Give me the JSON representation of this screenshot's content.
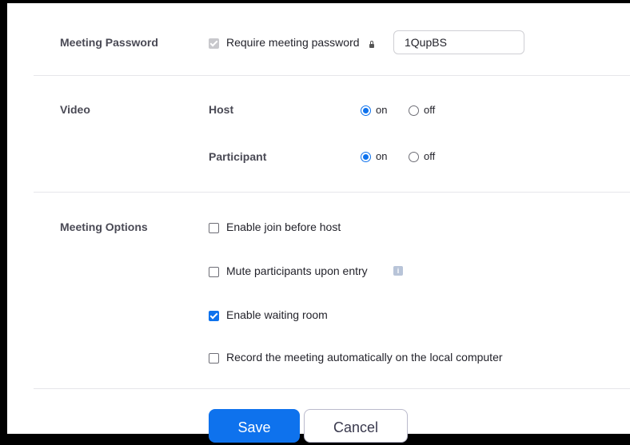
{
  "meeting_password": {
    "section_label": "Meeting Password",
    "require_label": "Require meeting password",
    "require_checked": true,
    "password_value": "1QupBS"
  },
  "video": {
    "section_label": "Video",
    "host": {
      "label": "Host",
      "on_label": "on",
      "off_label": "off",
      "selected": "on"
    },
    "participant": {
      "label": "Participant",
      "on_label": "on",
      "off_label": "off",
      "selected": "on"
    }
  },
  "meeting_options": {
    "section_label": "Meeting Options",
    "items": [
      {
        "label": "Enable join before host",
        "checked": false
      },
      {
        "label": "Mute participants upon entry",
        "checked": false
      },
      {
        "label": "Enable waiting room",
        "checked": true
      },
      {
        "label": "Record the meeting automatically on the local computer",
        "checked": false
      }
    ]
  },
  "actions": {
    "save_label": "Save",
    "cancel_label": "Cancel"
  },
  "colors": {
    "accent": "#0e72ed",
    "background": "#ffffff",
    "frame": "#000000"
  }
}
